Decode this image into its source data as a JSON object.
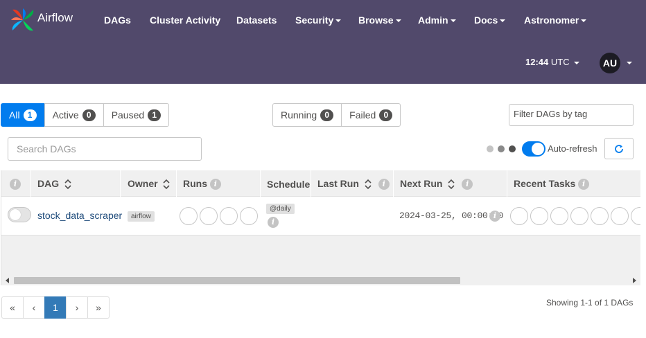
{
  "navbar": {
    "brand": "Airflow",
    "items": [
      {
        "label": "DAGs",
        "dropdown": false
      },
      {
        "label": "Cluster Activity",
        "dropdown": false
      },
      {
        "label": "Datasets",
        "dropdown": false
      },
      {
        "label": "Security",
        "dropdown": true
      },
      {
        "label": "Browse",
        "dropdown": true
      },
      {
        "label": "Admin",
        "dropdown": true
      },
      {
        "label": "Docs",
        "dropdown": true
      },
      {
        "label": "Astronomer",
        "dropdown": true
      }
    ],
    "clock_time": "12:44",
    "clock_zone": "UTC",
    "user_initials": "AU",
    "bg_color": "#51496b"
  },
  "filters": {
    "status": [
      {
        "label": "All",
        "count": "1",
        "active": true
      },
      {
        "label": "Active",
        "count": "0",
        "active": false
      },
      {
        "label": "Paused",
        "count": "1",
        "active": false
      }
    ],
    "run_state": [
      {
        "label": "Running",
        "count": "0"
      },
      {
        "label": "Failed",
        "count": "0"
      }
    ],
    "tag_placeholder": "Filter DAGs by tag",
    "search_placeholder": "Search DAGs",
    "auto_refresh_label": "Auto-refresh",
    "auto_refresh_on": true
  },
  "table": {
    "headers": {
      "info": "i",
      "dag": "DAG",
      "owner": "Owner",
      "runs": "Runs",
      "schedule": "Schedule",
      "last_run": "Last Run",
      "next_run": "Next Run",
      "recent_tasks": "Recent Tasks"
    },
    "rows": [
      {
        "dag_id": "stock_data_scraper",
        "owner": "airflow",
        "schedule": "@daily",
        "last_run": "",
        "next_run": "2024-03-25, 00:00:00",
        "paused": true
      }
    ]
  },
  "pagination": {
    "first": "«",
    "prev": "‹",
    "current": "1",
    "next": "›",
    "last": "»",
    "showing": "Showing 1-1 of 1 DAGs"
  },
  "colors": {
    "accent": "#017cee",
    "page_active": "#337ab7"
  }
}
